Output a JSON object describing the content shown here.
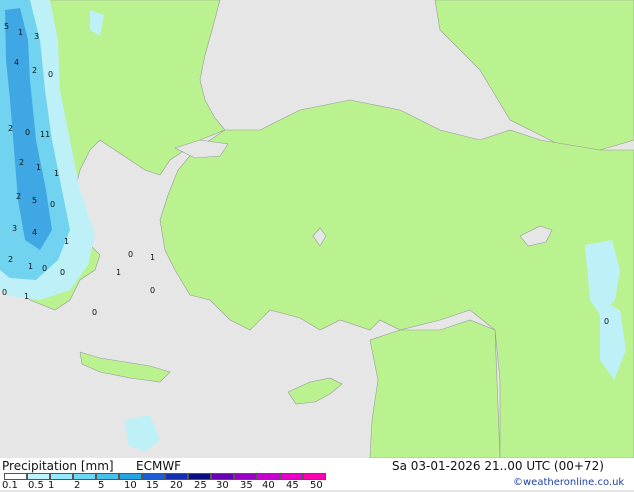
{
  "title": "Precipitation [mm]",
  "model": "ECMWF",
  "valid_time": "Sa 03-01-2026 21..00 UTC (00+72)",
  "credit": "©weatheronline.co.uk",
  "legend": {
    "ticks": [
      "0.1",
      "0.5",
      "1",
      "2",
      "5",
      "10",
      "15",
      "20",
      "25",
      "30",
      "35",
      "40",
      "45",
      "50"
    ],
    "colors": [
      "#ffffff",
      "#bff3ff",
      "#96eaff",
      "#6ed6f6",
      "#48c0ee",
      "#28a4e4",
      "#1c5ed8",
      "#142fb2",
      "#0c0f82",
      "#6a00b4",
      "#9a00c8",
      "#c800d2",
      "#e600c8",
      "#ff00b4"
    ]
  },
  "map_labels": [
    "5",
    "1",
    "3",
    "4",
    "2",
    "0",
    "2",
    "0",
    "11",
    "2",
    "1",
    "1",
    "2",
    "5",
    "0",
    "3",
    "4",
    "1",
    "2",
    "1",
    "0",
    "0",
    "0",
    "1",
    "0",
    "1",
    "1",
    "0",
    "0",
    "0"
  ],
  "colors": {
    "land": "#b9f28e",
    "sea": "#e6e6e6",
    "light_precip": "#bdf1f7",
    "mid_precip": "#72d3f0",
    "heavy_precip": "#3fa8e4"
  }
}
